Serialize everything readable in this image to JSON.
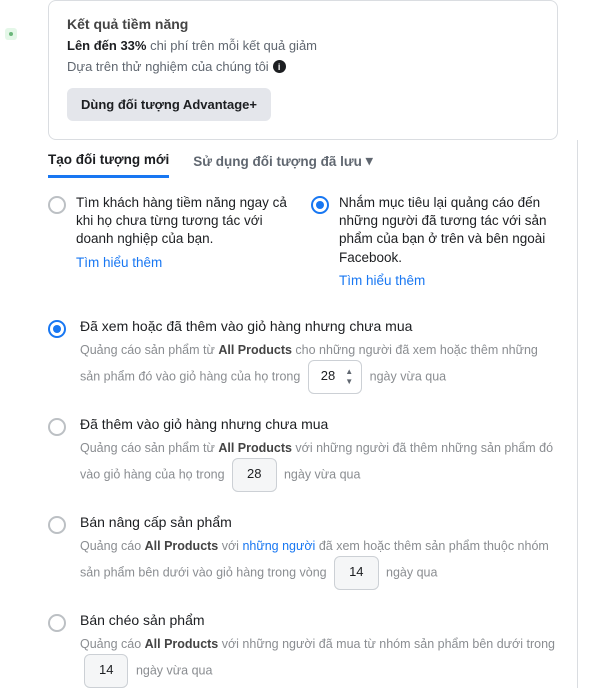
{
  "card": {
    "title": "Kết quả tiềm năng",
    "pct": "Lên đến 33%",
    "pct_rest": " chi phí trên mỗi kết quả giảm",
    "sub": "Dựa trên thử nghiệm của chúng tôi",
    "cta": "Dùng đối tượng Advantage+"
  },
  "tabs": {
    "t1": "Tạo đối tượng mới",
    "t2": "Sử dụng đối tượng đã lưu"
  },
  "radios": {
    "a": "Tìm khách hàng tiềm năng ngay cả khi họ chưa từng tương tác với doanh nghiệp của bạn.",
    "b": "Nhắm mục tiêu lại quảng cáo đến những người đã tương tác với sản phẩm của bạn ở trên và bên ngoài Facebook.",
    "learn": "Tìm hiểu thêm"
  },
  "opts": [
    {
      "title": "Đã xem hoặc đã thêm vào giỏ hàng nhưng chưa mua",
      "d1": "Quảng cáo sản phẩm từ ",
      "d1b": "All Products",
      "d2": " cho những người đã xem hoặc thêm những sản phẩm đó vào giỏ hàng của họ trong ",
      "val": "28",
      "d3": " ngày vừa qua",
      "spin": true,
      "sel": true
    },
    {
      "title": "Đã thêm vào giỏ hàng nhưng chưa mua",
      "d1": "Quảng cáo sản phẩm từ ",
      "d1b": "All Products",
      "d2": " với những người đã thêm những sản phẩm đó vào giỏ hàng của họ trong ",
      "val": "28",
      "d3": " ngày vừa qua",
      "spin": false,
      "sel": false
    },
    {
      "title": "Bán nâng cấp sản phẩm",
      "d1": "Quảng cáo ",
      "d1b": "All Products",
      "d2": " với ",
      "d2link": "những người",
      "d2b": " đã xem hoặc thêm sản phẩm thuộc nhóm sản phẩm bên dưới vào giỏ hàng trong vòng ",
      "val": "14",
      "d3": " ngày qua",
      "spin": false,
      "sel": false
    },
    {
      "title": "Bán chéo sản phẩm",
      "d1": "Quảng cáo ",
      "d1b": "All Products",
      "d2": " với những người đã mua từ nhóm sản phẩm bên dưới trong ",
      "val": "14",
      "d3": " ngày vừa qua",
      "spin": false,
      "sel": false
    }
  ]
}
